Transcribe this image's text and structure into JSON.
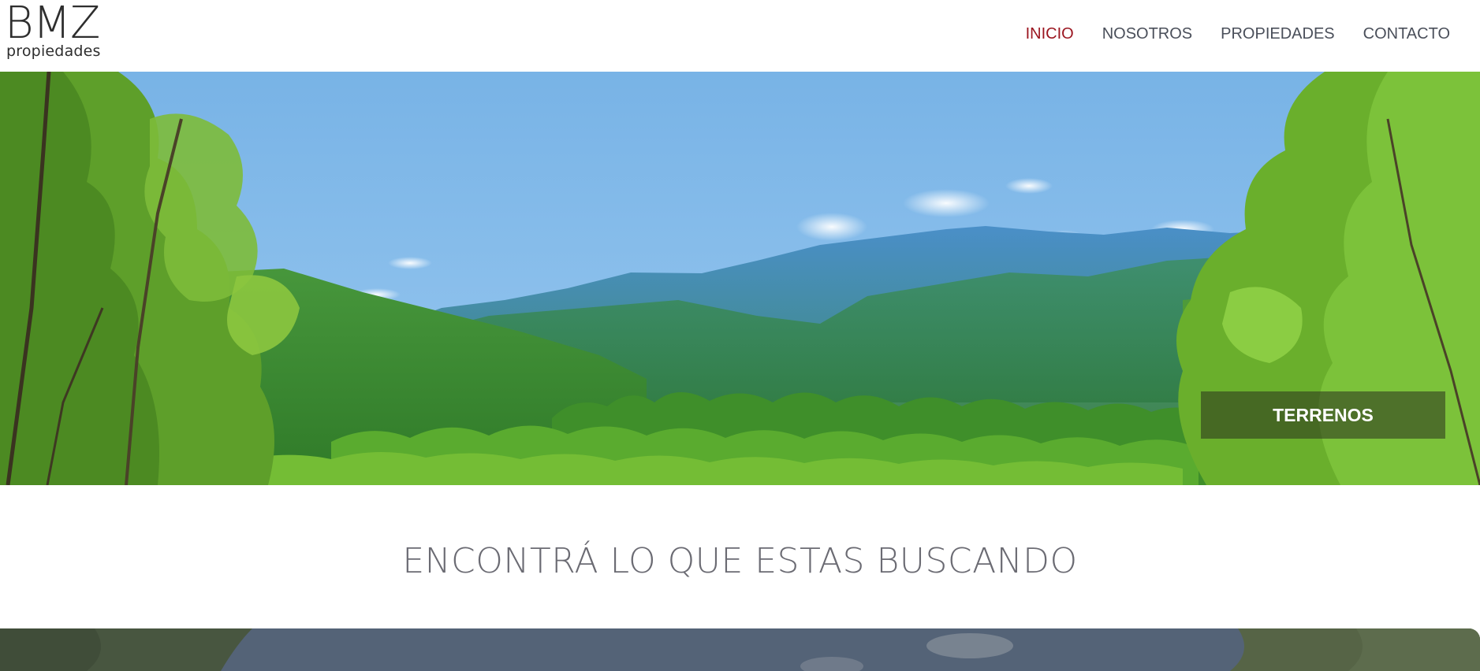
{
  "header": {
    "logo": {
      "main": "BMZ",
      "sub": "propiedades"
    },
    "nav": [
      {
        "label": "INICIO",
        "active": true
      },
      {
        "label": "NOSOTROS",
        "active": false
      },
      {
        "label": "PROPIEDADES",
        "active": false
      },
      {
        "label": "CONTACTO",
        "active": false
      }
    ]
  },
  "hero": {
    "badge_label": "TERRENOS"
  },
  "section": {
    "title": "ENCONTRÁ LO QUE ESTAS BUSCANDO"
  },
  "colors": {
    "nav_active": "#9b1620",
    "nav_default": "#4a4f5a",
    "title": "#6b6b73",
    "sky": "#7fb4e6"
  }
}
